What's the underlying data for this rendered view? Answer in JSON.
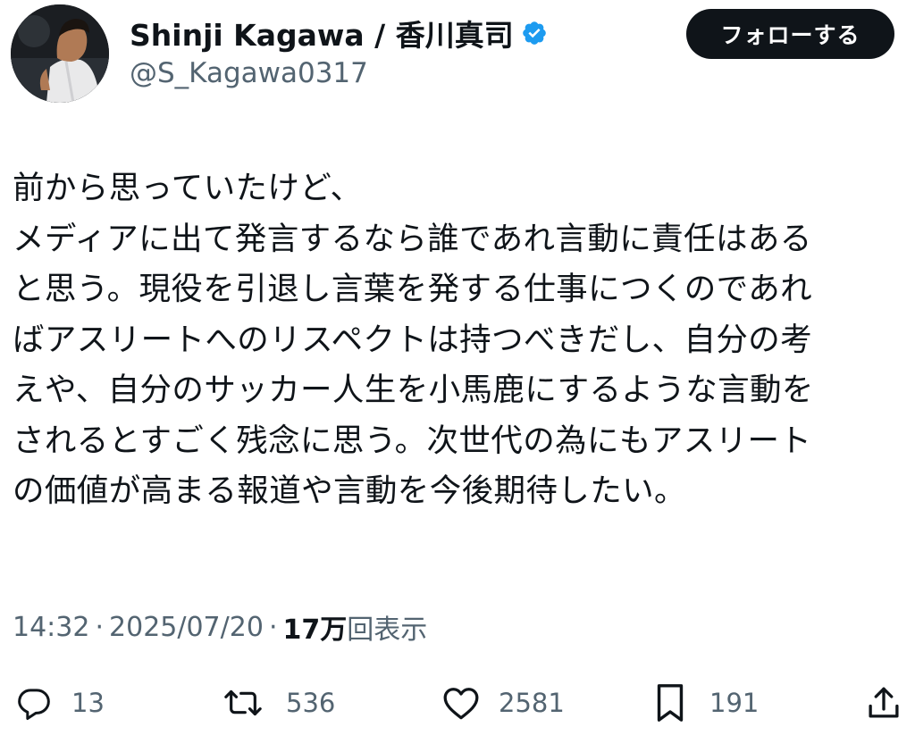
{
  "user": {
    "display_name": "Shinji Kagawa / 香川真司",
    "handle": "@S_Kagawa0317",
    "verified": true,
    "verified_color": "#1d9bf0"
  },
  "follow_button_label": "フォローする",
  "tweet": {
    "lines": [
      "前から思っていたけど、",
      "メディアに出て発言するなら誰であれ言動に責任はある",
      "と思う。現役を引退し言葉を発する仕事につくのであれ",
      "ばアスリートへのリスペクトは持つべきだし、自分の考",
      "えや、自分のサッカー人生を小馬鹿にするような言動を",
      "されるとすごく残念に思う。次世代の為にもアスリート",
      "の価値が高まる報道や言動を今後期待したい。"
    ]
  },
  "meta": {
    "time": "14:32",
    "separator": "·",
    "date": "2025/07/20",
    "views_count": "17万",
    "views_label": "回表示"
  },
  "actions": {
    "replies": "13",
    "retweets": "536",
    "likes": "2581",
    "bookmarks": "191"
  },
  "icons": {
    "reply": "reply-icon",
    "retweet": "retweet-icon",
    "like": "heart-icon",
    "bookmark": "bookmark-icon",
    "share": "share-icon"
  }
}
